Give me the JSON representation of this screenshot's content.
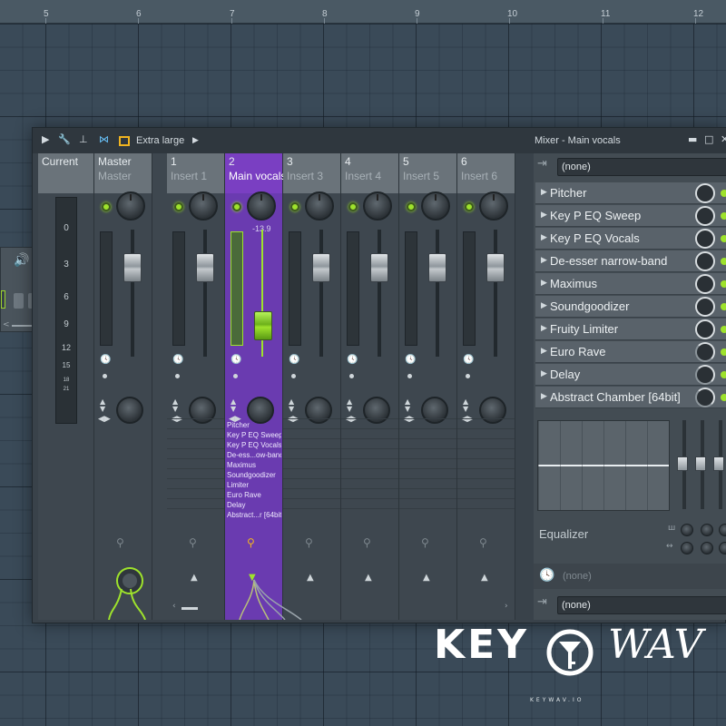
{
  "ruler": {
    "marks": [
      "5",
      "6",
      "7",
      "8",
      "9",
      "10",
      "11",
      "12"
    ]
  },
  "titlebar": {
    "size_label": "Extra large",
    "window_title": "Mixer - Main vocals",
    "icons": [
      "play-arrow-icon",
      "wrench-icon",
      "pin-icon",
      "bowtie-icon",
      "yellow-square-icon",
      "arrow-right-icon"
    ],
    "window_controls": [
      "minimize-icon",
      "maximize-icon",
      "close-icon"
    ]
  },
  "scale": {
    "label": "Current",
    "ticks": [
      "0",
      "3",
      "6",
      "9",
      "12",
      "15",
      "18",
      "21"
    ]
  },
  "master": {
    "num": "Master",
    "name": "Master"
  },
  "inserts": [
    {
      "num": "1",
      "name": "Insert 1",
      "selected": false
    },
    {
      "num": "2",
      "name": "Main vocals",
      "selected": true
    },
    {
      "num": "3",
      "name": "Insert 3",
      "selected": false
    },
    {
      "num": "4",
      "name": "Insert 4",
      "selected": false
    },
    {
      "num": "5",
      "name": "Insert 5",
      "selected": false
    },
    {
      "num": "6",
      "name": "Insert 6",
      "selected": false
    }
  ],
  "selected_readout": "-13.9",
  "selected_fx": [
    "Pitcher",
    "Key P EQ Sweep",
    "Key P EQ Vocals",
    "De-ess...ow-band",
    "Maximus",
    "Soundgoodizer",
    "Limiter",
    "Euro Rave",
    "Delay",
    "Abstract...r [64bit]"
  ],
  "right_panel": {
    "input": "(none)",
    "output": "(none)",
    "slots": [
      {
        "label": "Pitcher",
        "mix": "full"
      },
      {
        "label": "Key P EQ Sweep",
        "mix": "full"
      },
      {
        "label": "Key P EQ Vocals",
        "mix": "full"
      },
      {
        "label": "De-esser narrow-band",
        "mix": "full"
      },
      {
        "label": "Maximus",
        "mix": "full"
      },
      {
        "label": "Soundgoodizer",
        "mix": "full"
      },
      {
        "label": "Fruity Limiter",
        "mix": "full"
      },
      {
        "label": "Euro Rave",
        "mix": "half"
      },
      {
        "label": "Delay",
        "mix": "half"
      },
      {
        "label": "Abstract Chamber [64bit]",
        "mix": "half"
      }
    ],
    "eq_label": "Equalizer",
    "time_label": "(none)"
  },
  "logo": {
    "key": "KEY",
    "wav": "WAV",
    "sub": "KEYWAV.IO"
  },
  "colors": {
    "accent_green": "#9ee22c",
    "selected_purple": "#7a3fc2",
    "yellow": "#f0b420"
  }
}
